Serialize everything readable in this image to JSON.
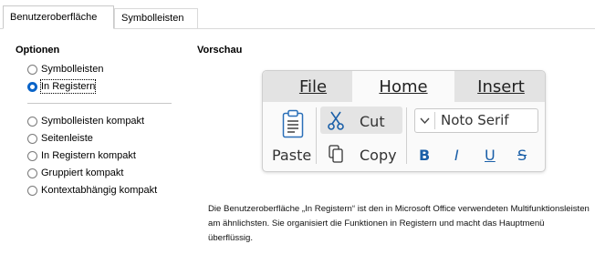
{
  "tabs": [
    {
      "label": "Benutzeroberfläche",
      "active": true
    },
    {
      "label": "Symbolleisten",
      "active": false
    }
  ],
  "options": {
    "title": "Optionen",
    "items": [
      {
        "label": "Symbolleisten",
        "checked": false
      },
      {
        "label": "In Registern",
        "checked": true
      },
      {
        "label": "Symbolleisten kompakt",
        "checked": false
      },
      {
        "label": "Seitenleiste",
        "checked": false
      },
      {
        "label": "In Registern kompakt",
        "checked": false
      },
      {
        "label": "Gruppiert kompakt",
        "checked": false
      },
      {
        "label": "Kontextabhängig kompakt",
        "checked": false
      }
    ]
  },
  "preview": {
    "title": "Vorschau",
    "tabs": [
      "File",
      "Home",
      "Insert"
    ],
    "paste_label": "Paste",
    "cut_label": "Cut",
    "copy_label": "Copy",
    "font_name": "Noto Serif",
    "format_buttons": {
      "bold": "B",
      "italic": "I",
      "underline": "U",
      "strike": "S"
    },
    "accent_color": "#1a5fa8"
  },
  "description": "Die Benutzeroberfläche „In Registern“ ist den in Microsoft Office verwendeten Multifunktionsleisten am ähnlichsten. Sie organisiert die Funktionen in Registern und macht das Hauptmenü überflüssig.",
  "colors": {
    "radio_selected": "#0a64c8",
    "tab_border": "#d9d9d9"
  }
}
